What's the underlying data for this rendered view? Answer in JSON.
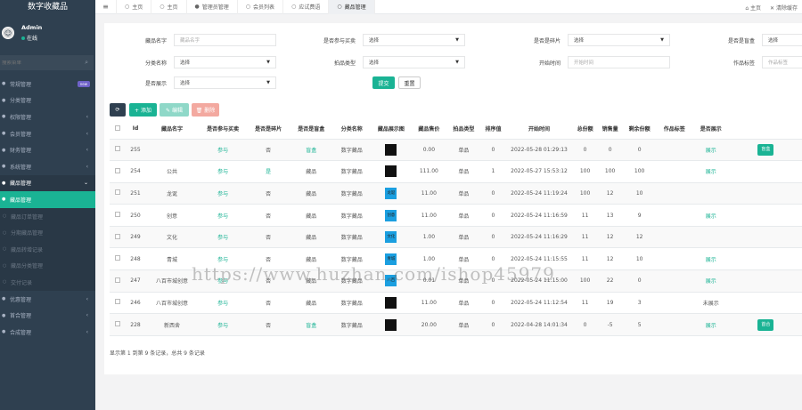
{
  "app": {
    "brand": "数字收藏品"
  },
  "user": {
    "name": "Admin",
    "status": "在线"
  },
  "search": {
    "placeholder": "搜索菜单"
  },
  "menu": [
    {
      "label": "常规管理",
      "badge": "new",
      "state": "normal"
    },
    {
      "label": "分类管理",
      "state": "normal"
    },
    {
      "label": "权限管理",
      "chevron": "‹",
      "state": "normal"
    },
    {
      "label": "会员管理",
      "chevron": "‹",
      "state": "normal"
    },
    {
      "label": "财务管理",
      "chevron": "‹",
      "state": "normal"
    },
    {
      "label": "系统管理",
      "chevron": "‹",
      "state": "normal"
    },
    {
      "label": "藏品管理",
      "chevron": "⌄",
      "state": "open"
    },
    {
      "label": "藏品管理",
      "state": "active"
    },
    {
      "label": "藏品订单管理",
      "state": "sub"
    },
    {
      "label": "分期藏品管理",
      "state": "sub"
    },
    {
      "label": "藏品转增记录",
      "state": "sub"
    },
    {
      "label": "藏品分类管理",
      "state": "sub"
    },
    {
      "label": "交付记录",
      "state": "sub"
    },
    {
      "label": "优惠管理",
      "chevron": "‹",
      "state": "normal"
    },
    {
      "label": "首合管理",
      "chevron": "‹",
      "state": "normal"
    },
    {
      "label": "合成管理",
      "chevron": "‹",
      "state": "normal"
    }
  ],
  "topbar": {
    "tabs": [
      {
        "label": "主页",
        "icon": "○"
      },
      {
        "label": "主页",
        "icon": "○"
      },
      {
        "label": "管理员管理",
        "icon": "●"
      },
      {
        "label": "会员列表",
        "icon": "○"
      },
      {
        "label": "应试费语",
        "icon": "○"
      },
      {
        "label": "藏品管理",
        "icon": "○",
        "active": true
      }
    ],
    "right": [
      "主页",
      "清除缓存"
    ]
  },
  "filters": {
    "name_label": "藏品名字",
    "name_placeholder": "藏品名字",
    "join_label": "是否参与买卖",
    "join_value": "选择",
    "fragment_label": "是否是碎片",
    "fragment_value": "选择",
    "blindbox_label": "是否是盲盒",
    "blindbox_value": "选择",
    "category_label": "分类名称",
    "category_value": "选择",
    "auction_label": "拍品类型",
    "auction_value": "选择",
    "start_label": "开始时间",
    "start_placeholder": "开始时间",
    "tag_label": "作品标签",
    "tag_placeholder": "作品标签",
    "display_label": "是否展示",
    "display_value": "选择",
    "submit": "提交",
    "reset": "重置"
  },
  "toolbar": {
    "refresh": "⟳",
    "add": "+ 添加",
    "edit": "✎ 编辑",
    "delete": "🗑 删除"
  },
  "table": {
    "headers": [
      "",
      "Id",
      "藏品名字",
      "是否参与买卖",
      "是否是碎片",
      "是否是盲盒",
      "分类名称",
      "藏品展示图",
      "藏品售价",
      "拍品类型",
      "排序值",
      "开始时间",
      "总份额",
      "销售量",
      "剩余份额",
      "作品标签",
      "是否展示",
      ""
    ],
    "rows": [
      {
        "id": "255",
        "name": "",
        "join": "参与",
        "frag": "否",
        "box": "盲盒",
        "cat": "数字藏品",
        "img": "",
        "price": "0.00",
        "type": "单品",
        "sort": "0",
        "time": "2022-05-28 01:29:13",
        "total": "0",
        "sold": "0",
        "left": "0",
        "tag": "",
        "show": "展示",
        "btn": "盲盒"
      },
      {
        "id": "254",
        "name": "公共",
        "join": "参与",
        "frag": "是",
        "box": "藏品",
        "cat": "数字藏品",
        "img": "",
        "price": "111.00",
        "type": "单品",
        "sort": "1",
        "time": "2022-05-27 15:53:12",
        "total": "100",
        "sold": "100",
        "left": "100",
        "tag": "",
        "show": "展示",
        "btn": ""
      },
      {
        "id": "251",
        "name": "龙诞",
        "join": "参与",
        "frag": "否",
        "box": "藏品",
        "cat": "数字藏品",
        "img": "龙诞",
        "price": "11.00",
        "type": "单品",
        "sort": "0",
        "time": "2022-05-24 11:19:24",
        "total": "100",
        "sold": "12",
        "left": "10",
        "tag": "",
        "show": "",
        "btn": ""
      },
      {
        "id": "250",
        "name": "创意",
        "join": "参与",
        "frag": "否",
        "box": "藏品",
        "cat": "数字藏品",
        "img": "创意",
        "price": "11.00",
        "type": "单品",
        "sort": "0",
        "time": "2022-05-24 11:16:59",
        "total": "11",
        "sold": "13",
        "left": "9",
        "tag": "",
        "show": "展示",
        "btn": ""
      },
      {
        "id": "249",
        "name": "文化",
        "join": "参与",
        "frag": "否",
        "box": "藏品",
        "cat": "数字藏品",
        "img": "文化",
        "price": "1.00",
        "type": "单品",
        "sort": "0",
        "time": "2022-05-24 11:16:29",
        "total": "11",
        "sold": "12",
        "left": "12",
        "tag": "",
        "show": "",
        "btn": ""
      },
      {
        "id": "248",
        "name": "青城",
        "join": "参与",
        "frag": "否",
        "box": "藏品",
        "cat": "数字藏品",
        "img": "青城",
        "price": "1.00",
        "type": "单品",
        "sort": "0",
        "time": "2022-05-24 11:15:55",
        "total": "11",
        "sold": "12",
        "left": "10",
        "tag": "",
        "show": "展示",
        "btn": ""
      },
      {
        "id": "247",
        "name": "八百市城创意",
        "join": "参与",
        "frag": "否",
        "box": "藏品",
        "cat": "数字藏品",
        "img": "八百",
        "price": "0.01",
        "type": "单品",
        "sort": "0",
        "time": "2022-05-24 11:15:00",
        "total": "100",
        "sold": "22",
        "left": "0",
        "tag": "",
        "show": "展示",
        "btn": ""
      },
      {
        "id": "246",
        "name": "八百市城创意",
        "join": "参与",
        "frag": "否",
        "box": "藏品",
        "cat": "数字藏品",
        "img": "",
        "price": "11.00",
        "type": "单品",
        "sort": "0",
        "time": "2022-05-24 11:12:54",
        "total": "11",
        "sold": "19",
        "left": "3",
        "tag": "",
        "show": "未展示",
        "btn": ""
      },
      {
        "id": "228",
        "name": "新西舍",
        "join": "参与",
        "frag": "否",
        "box": "盲盒",
        "cat": "数字藏品",
        "img": "",
        "price": "20.00",
        "type": "单品",
        "sort": "0",
        "time": "2022-04-28 14:01:34",
        "total": "0",
        "sold": "-5",
        "left": "5",
        "tag": "",
        "show": "展示",
        "btn": "首合"
      }
    ]
  },
  "footer": {
    "summary": "显示第 1 到第 9 条记录，总共 9 条记录"
  },
  "watermark": "https://www.huzhan.com/ishop45979"
}
